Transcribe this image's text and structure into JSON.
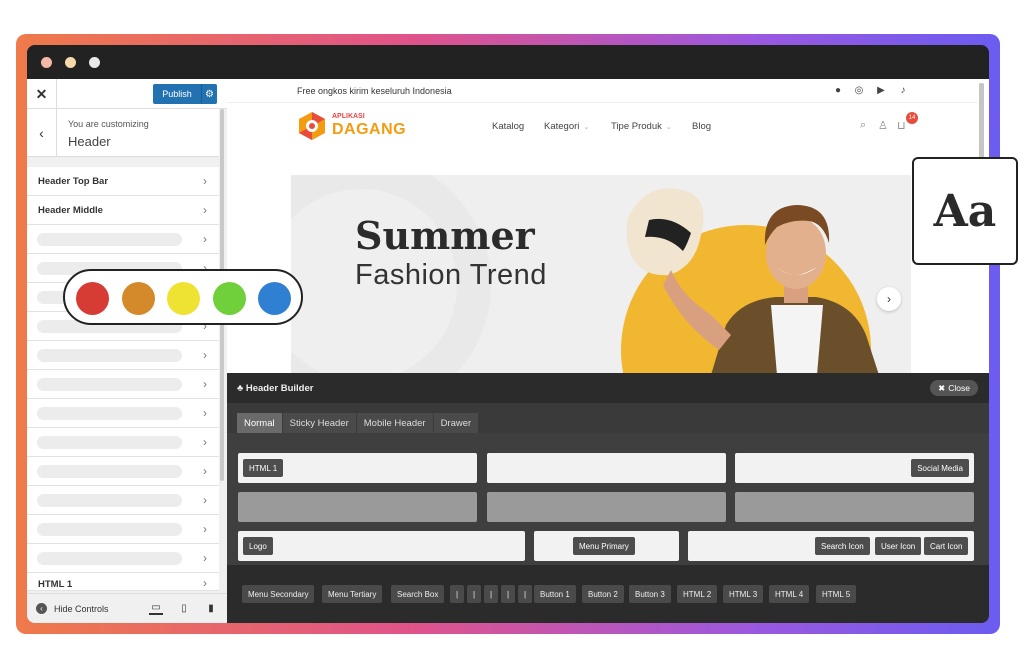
{
  "sidebar": {
    "close_label": "✕",
    "publish_label": "Publish",
    "you_are_customizing": "You are customizing",
    "section_title": "Header",
    "items": [
      {
        "label": "Header Top Bar"
      },
      {
        "label": "Header Middle"
      }
    ],
    "bottom_item_label": "HTML 1",
    "hide_controls_label": "Hide Controls"
  },
  "site": {
    "topbar_text": "Free ongkos kirim keseluruh Indonesia",
    "logo_small": "APLIKASI",
    "logo_big": "DAGANG",
    "nav": [
      "Katalog",
      "Kategori",
      "Tipe Produk",
      "Blog"
    ],
    "cart_count": "14",
    "hero_title": "Summer",
    "hero_subtitle": "Fashion Trend"
  },
  "header_builder": {
    "title": "Header Builder",
    "close_label": "Close",
    "tabs": [
      "Normal",
      "Sticky Header",
      "Mobile Header",
      "Drawer"
    ],
    "active_tab": "Normal",
    "top_row": {
      "left": "HTML 1",
      "right": "Social Media"
    },
    "main_row": {
      "left": "Logo",
      "center": "Menu Primary",
      "right": [
        "Search Icon",
        "User Icon",
        "Cart Icon"
      ]
    },
    "available": [
      "Menu Secondary",
      "Menu Tertiary",
      "Search Box",
      "|",
      "|",
      "|",
      "|",
      "|",
      "Button 1",
      "Button 2",
      "Button 3",
      "HTML 2",
      "HTML 3",
      "HTML 4",
      "HTML 5"
    ]
  },
  "palette": {
    "colors": [
      "#d63c34",
      "#d48a2a",
      "#eee233",
      "#6fd03b",
      "#2f7fd2"
    ]
  },
  "typography_card": {
    "label": "Aa"
  },
  "colors": {
    "accent": "#2271b1",
    "brand_orange": "#f39c12",
    "badge": "#e74c3c"
  }
}
